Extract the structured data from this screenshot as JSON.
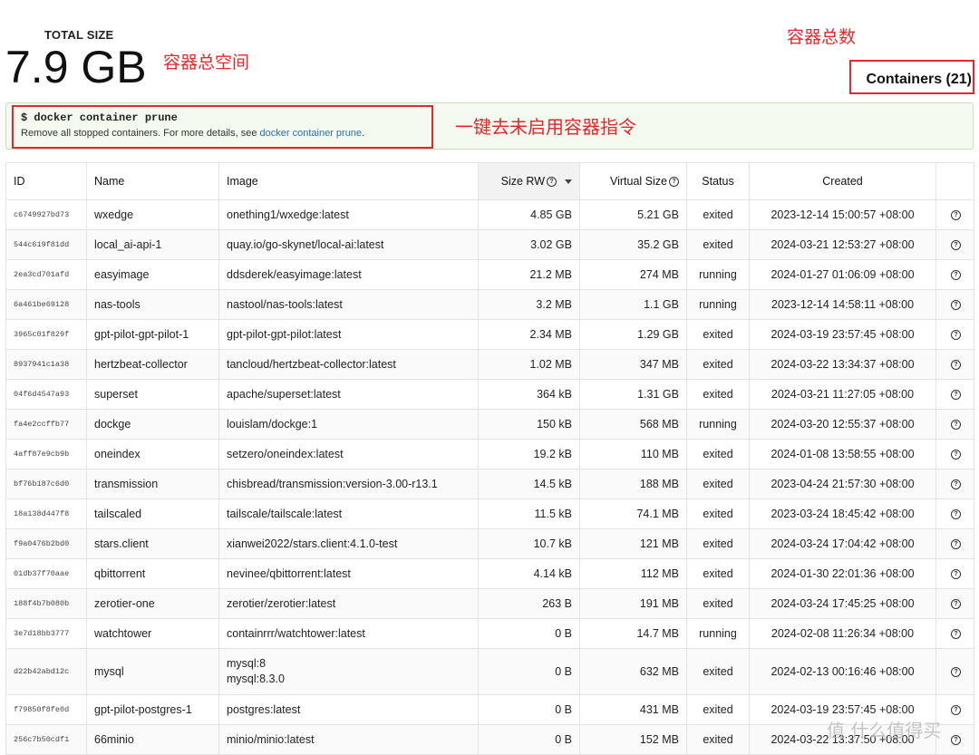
{
  "summary": {
    "total_label": "TOTAL SIZE",
    "total_value": "7.9 GB",
    "containers_label": "Containers (21)"
  },
  "annotations": {
    "space": "容器总空间",
    "count": "容器总数",
    "prune": "一键去未启用容器指令"
  },
  "prune": {
    "command": "$ docker container prune",
    "desc_prefix": "Remove all stopped containers. For more details, see ",
    "link_text": "docker container prune",
    "desc_suffix": "."
  },
  "table": {
    "headers": {
      "id": "ID",
      "name": "Name",
      "image": "Image",
      "size_rw": "Size RW",
      "virtual_size": "Virtual Size",
      "status": "Status",
      "created": "Created"
    },
    "rows": [
      {
        "id": "c6749927bd73",
        "name": "wxedge",
        "image": [
          "onething1/wxedge:latest"
        ],
        "size_rw": "4.85 GB",
        "virtual_size": "5.21 GB",
        "status": "exited",
        "created": "2023-12-14 15:00:57 +08:00"
      },
      {
        "id": "544c619f81dd",
        "name": "local_ai-api-1",
        "image": [
          "quay.io/go-skynet/local-ai:latest"
        ],
        "size_rw": "3.02 GB",
        "virtual_size": "35.2 GB",
        "status": "exited",
        "created": "2024-03-21 12:53:27 +08:00"
      },
      {
        "id": "2ea3cd701afd",
        "name": "easyimage",
        "image": [
          "ddsderek/easyimage:latest"
        ],
        "size_rw": "21.2 MB",
        "virtual_size": "274 MB",
        "status": "running",
        "created": "2024-01-27 01:06:09 +08:00"
      },
      {
        "id": "6a461be69128",
        "name": "nas-tools",
        "image": [
          "nastool/nas-tools:latest"
        ],
        "size_rw": "3.2 MB",
        "virtual_size": "1.1 GB",
        "status": "running",
        "created": "2023-12-14 14:58:11 +08:00"
      },
      {
        "id": "3965c01f829f",
        "name": "gpt-pilot-gpt-pilot-1",
        "image": [
          "gpt-pilot-gpt-pilot:latest"
        ],
        "size_rw": "2.34 MB",
        "virtual_size": "1.29 GB",
        "status": "exited",
        "created": "2024-03-19 23:57:45 +08:00"
      },
      {
        "id": "8937941c1a38",
        "name": "hertzbeat-collector",
        "image": [
          "tancloud/hertzbeat-collector:latest"
        ],
        "size_rw": "1.02 MB",
        "virtual_size": "347 MB",
        "status": "exited",
        "created": "2024-03-22 13:34:37 +08:00"
      },
      {
        "id": "04f6d4547a93",
        "name": "superset",
        "image": [
          "apache/superset:latest"
        ],
        "size_rw": "364 kB",
        "virtual_size": "1.31 GB",
        "status": "exited",
        "created": "2024-03-21 11:27:05 +08:00"
      },
      {
        "id": "fa4e2ccffb77",
        "name": "dockge",
        "image": [
          "louislam/dockge:1"
        ],
        "size_rw": "150 kB",
        "virtual_size": "568 MB",
        "status": "running",
        "created": "2024-03-20 12:55:37 +08:00"
      },
      {
        "id": "4aff87e9cb9b",
        "name": "oneindex",
        "image": [
          "setzero/oneindex:latest"
        ],
        "size_rw": "19.2 kB",
        "virtual_size": "110 MB",
        "status": "exited",
        "created": "2024-01-08 13:58:55 +08:00"
      },
      {
        "id": "bf76b187c6d0",
        "name": "transmission",
        "image": [
          "chisbread/transmission:version-3.00-r13.1"
        ],
        "size_rw": "14.5 kB",
        "virtual_size": "188 MB",
        "status": "exited",
        "created": "2023-04-24 21:57:30 +08:00"
      },
      {
        "id": "18a138d447f8",
        "name": "tailscaled",
        "image": [
          "tailscale/tailscale:latest"
        ],
        "size_rw": "11.5 kB",
        "virtual_size": "74.1 MB",
        "status": "exited",
        "created": "2023-03-24 18:45:42 +08:00"
      },
      {
        "id": "f9a0476b2bd0",
        "name": "stars.client",
        "image": [
          "xianwei2022/stars.client:4.1.0-test"
        ],
        "size_rw": "10.7 kB",
        "virtual_size": "121 MB",
        "status": "exited",
        "created": "2024-03-24 17:04:42 +08:00"
      },
      {
        "id": "01db37f70aae",
        "name": "qbittorrent",
        "image": [
          "nevinee/qbittorrent:latest"
        ],
        "size_rw": "4.14 kB",
        "virtual_size": "112 MB",
        "status": "exited",
        "created": "2024-01-30 22:01:36 +08:00"
      },
      {
        "id": "188f4b7b080b",
        "name": "zerotier-one",
        "image": [
          "zerotier/zerotier:latest"
        ],
        "size_rw": "263 B",
        "virtual_size": "191 MB",
        "status": "exited",
        "created": "2024-03-24 17:45:25 +08:00"
      },
      {
        "id": "3e7d18bb3777",
        "name": "watchtower",
        "image": [
          "containrrr/watchtower:latest"
        ],
        "size_rw": "0 B",
        "virtual_size": "14.7 MB",
        "status": "running",
        "created": "2024-02-08 11:26:34 +08:00"
      },
      {
        "id": "d22b42abd12c",
        "name": "mysql",
        "image": [
          "mysql:8",
          "mysql:8.3.0"
        ],
        "size_rw": "0 B",
        "virtual_size": "632 MB",
        "status": "exited",
        "created": "2024-02-13 00:16:46 +08:00"
      },
      {
        "id": "f79850f8fe0d",
        "name": "gpt-pilot-postgres-1",
        "image": [
          "postgres:latest"
        ],
        "size_rw": "0 B",
        "virtual_size": "431 MB",
        "status": "exited",
        "created": "2024-03-19 23:57:45 +08:00"
      },
      {
        "id": "256c7b50cdf1",
        "name": "66minio",
        "image": [
          "minio/minio:latest"
        ],
        "size_rw": "0 B",
        "virtual_size": "152 MB",
        "status": "exited",
        "created": "2024-03-22 13:37:50 +08:00"
      }
    ]
  },
  "watermark": "值 什么值得买"
}
